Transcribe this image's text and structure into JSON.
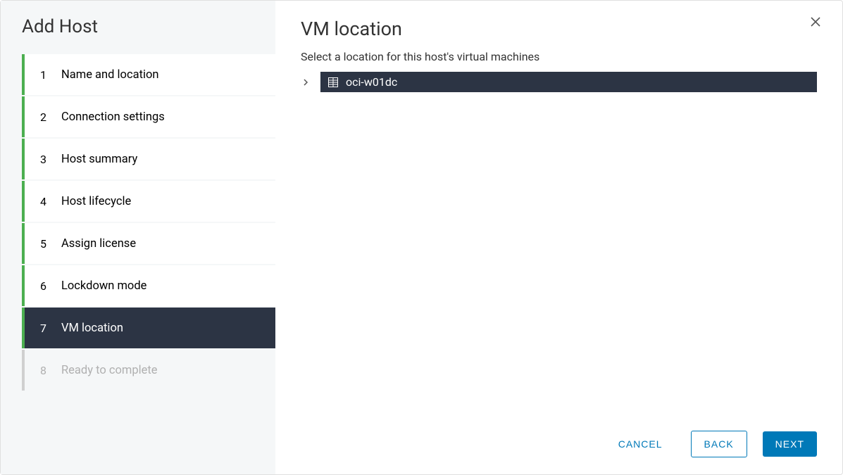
{
  "sidebar": {
    "title": "Add Host",
    "steps": [
      {
        "number": "1",
        "label": "Name and location"
      },
      {
        "number": "2",
        "label": "Connection settings"
      },
      {
        "number": "3",
        "label": "Host summary"
      },
      {
        "number": "4",
        "label": "Host lifecycle"
      },
      {
        "number": "5",
        "label": "Assign license"
      },
      {
        "number": "6",
        "label": "Lockdown mode"
      },
      {
        "number": "7",
        "label": "VM location"
      },
      {
        "number": "8",
        "label": "Ready to complete"
      }
    ]
  },
  "main": {
    "title": "VM location",
    "subtitle": "Select a location for this host's virtual machines",
    "tree": {
      "item_label": "oci-w01dc"
    }
  },
  "footer": {
    "cancel": "CANCEL",
    "back": "BACK",
    "next": "NEXT"
  }
}
